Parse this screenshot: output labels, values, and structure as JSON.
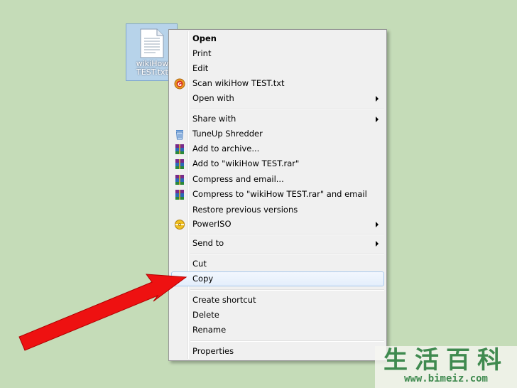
{
  "desktop": {
    "file_icon": {
      "icon": "text-file-icon",
      "caption_line1": "wikiHow",
      "caption_line2": "TEST.txt"
    }
  },
  "context_menu": {
    "items": [
      {
        "label": "Open",
        "bold": true
      },
      {
        "label": "Print"
      },
      {
        "label": "Edit"
      },
      {
        "label": "Scan wikiHow TEST.txt",
        "icon": "antivirus-scan-icon"
      },
      {
        "label": "Open with",
        "submenu": true
      },
      {
        "label": "Share with",
        "submenu": true
      },
      {
        "label": "TuneUp Shredder",
        "icon": "shredder-bin-icon"
      },
      {
        "label": "Add to archive...",
        "icon": "winrar-icon"
      },
      {
        "label": "Add to \"wikiHow TEST.rar\"",
        "icon": "winrar-icon"
      },
      {
        "label": "Compress and email...",
        "icon": "winrar-icon"
      },
      {
        "label": "Compress to \"wikiHow TEST.rar\" and email",
        "icon": "winrar-icon"
      },
      {
        "label": "Restore previous versions"
      },
      {
        "label": "PowerISO",
        "icon": "poweriso-disc-icon",
        "submenu": true
      },
      {
        "label": "Send to",
        "submenu": true
      },
      {
        "label": "Cut"
      },
      {
        "label": "Copy",
        "highlighted": true
      },
      {
        "label": "Create shortcut"
      },
      {
        "label": "Delete"
      },
      {
        "label": "Rename"
      },
      {
        "label": "Properties"
      }
    ]
  },
  "annotation": {
    "icon": "red-pointer-arrow-icon",
    "color": "#ee1111"
  },
  "watermark": {
    "title": "生活百科",
    "url": "www.bimeiz.com"
  }
}
